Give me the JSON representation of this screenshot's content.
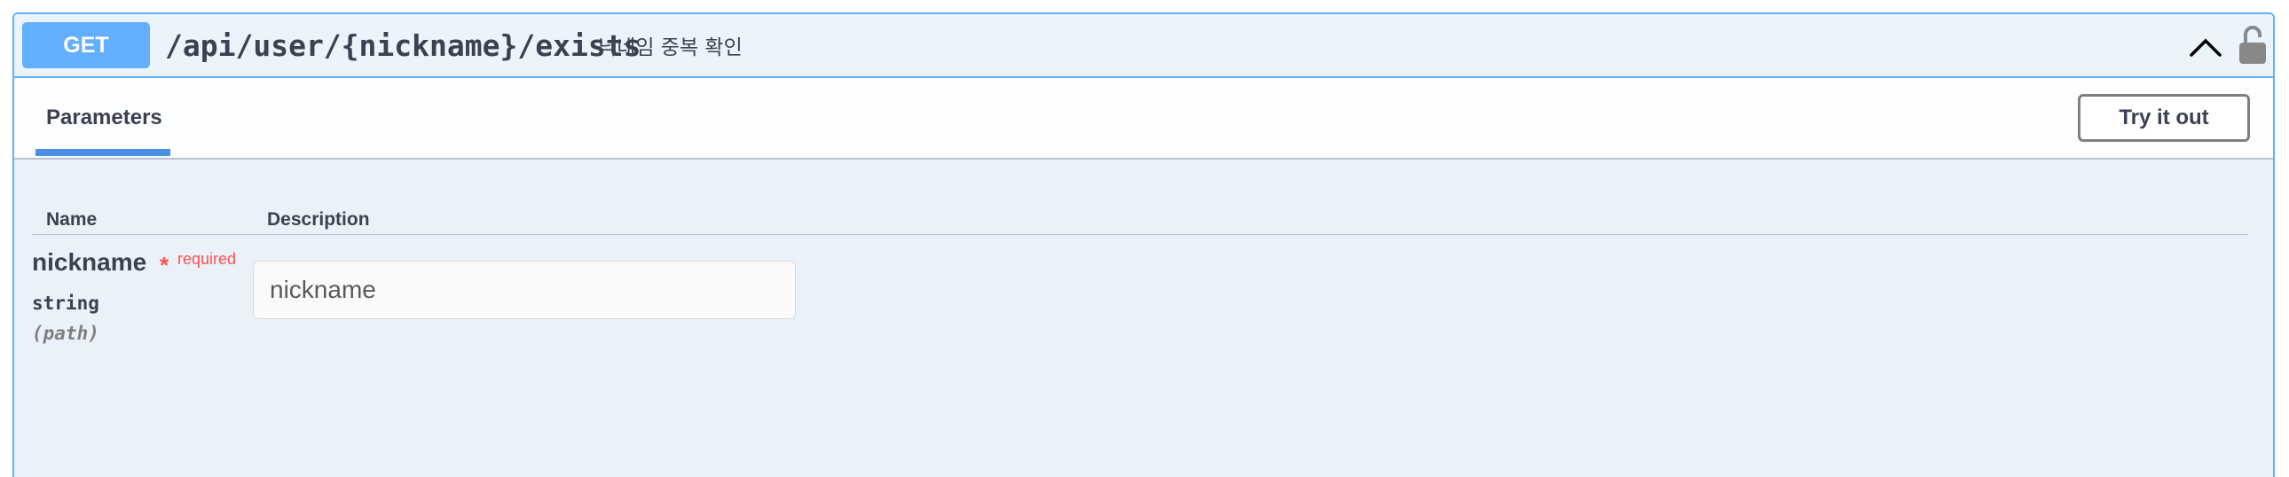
{
  "operation": {
    "method": "GET",
    "path": "/api/user/{nickname}/exists",
    "summary": "닉네임 중복 확인",
    "method_color": "#61affe",
    "collapse_icon": "chevron-up-icon",
    "lock_icon": "unlocked-padlock-icon"
  },
  "tabs": [
    {
      "label": "Parameters",
      "active": true
    }
  ],
  "try_button": {
    "label": "Try it out"
  },
  "params_table": {
    "headers": [
      "Name",
      "Description"
    ],
    "rows": [
      {
        "name": "nickname",
        "required_mark": "*",
        "required_label": "required",
        "type": "string",
        "location": "(path)",
        "input_value": "",
        "placeholder": "nickname"
      }
    ]
  },
  "colors": {
    "accent": "#61affe",
    "required": "#ff4f4f",
    "tab_underline": "#4990e2"
  }
}
